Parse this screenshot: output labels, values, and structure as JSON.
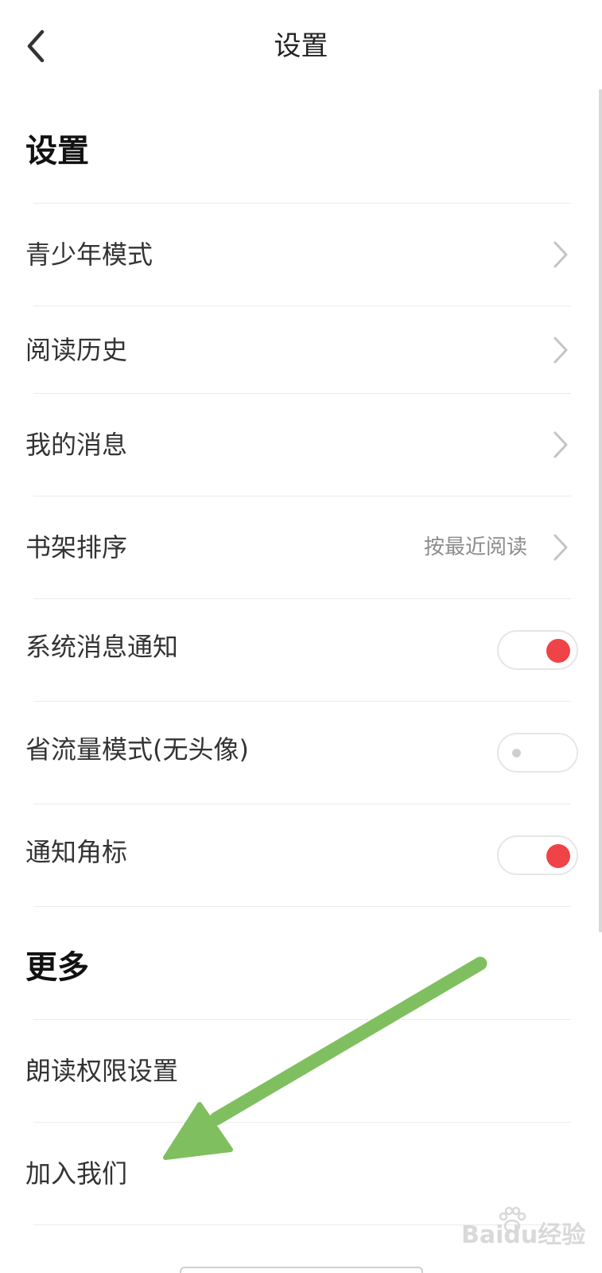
{
  "header": {
    "title": "设置",
    "back_icon": "chevron-left-icon"
  },
  "sections": {
    "settings": {
      "title": "设置",
      "items": {
        "youth_mode": {
          "label": "青少年模式",
          "icon": "chevron-right-icon"
        },
        "reading_history": {
          "label": "阅读历史",
          "icon": "chevron-right-icon"
        },
        "my_messages": {
          "label": "我的消息",
          "icon": "chevron-right-icon"
        },
        "shelf_sort": {
          "label": "书架排序",
          "value": "按最近阅读",
          "icon": "chevron-right-icon"
        },
        "system_notification": {
          "label": "系统消息通知",
          "enabled": true
        },
        "data_saver": {
          "label": "省流量模式(无头像)",
          "enabled": false
        },
        "badge": {
          "label": "通知角标",
          "enabled": true
        }
      }
    },
    "more": {
      "title": "更多",
      "items": {
        "read_aloud_permission": {
          "label": "朗读权限设置"
        },
        "join_us": {
          "label": "加入我们"
        }
      }
    }
  },
  "watermark": {
    "text": "Baidu经验",
    "icon": "paw-icon"
  },
  "colors": {
    "accent": "#ef4347",
    "annotation_arrow": "#7fbf5f",
    "divider": "#ececec",
    "secondary_text": "#8c8c8c"
  }
}
